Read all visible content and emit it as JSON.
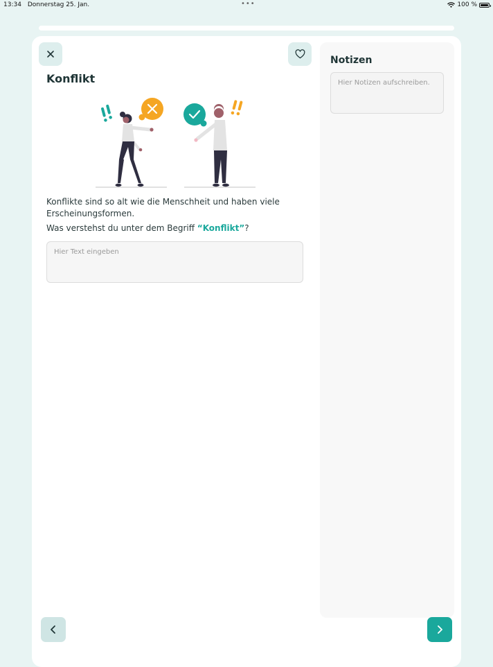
{
  "status_bar": {
    "time": "13:34",
    "date": "Donnerstag 25. Jan.",
    "battery": "100 %",
    "battery_level": 1.0,
    "icons": [
      "wifi-icon",
      "battery-icon"
    ]
  },
  "progress": {
    "fraction": 1.0
  },
  "lesson": {
    "title": "Konflikt",
    "intro": "Konflikte sind so alt wie die Menschheit und haben viele Erscheinungsformen.",
    "question_prefix": "Was verstehst du unter dem Begriff ",
    "question_keyword": "“Konflikt”",
    "question_suffix": "?",
    "answer_placeholder": "Hier Text eingeben",
    "answer_value": ""
  },
  "notes": {
    "title": "Notizen",
    "placeholder": "Hier Notizen aufschreiben.",
    "value": ""
  },
  "icons": {
    "close": "close-icon",
    "favorite": "heart-icon",
    "back": "chevron-left-icon",
    "next": "chevron-right-icon"
  },
  "colors": {
    "accent": "#1aa89c",
    "background": "#e8f4f3",
    "icon_button_bg": "#ddeeed",
    "warning": "#f5a623"
  }
}
